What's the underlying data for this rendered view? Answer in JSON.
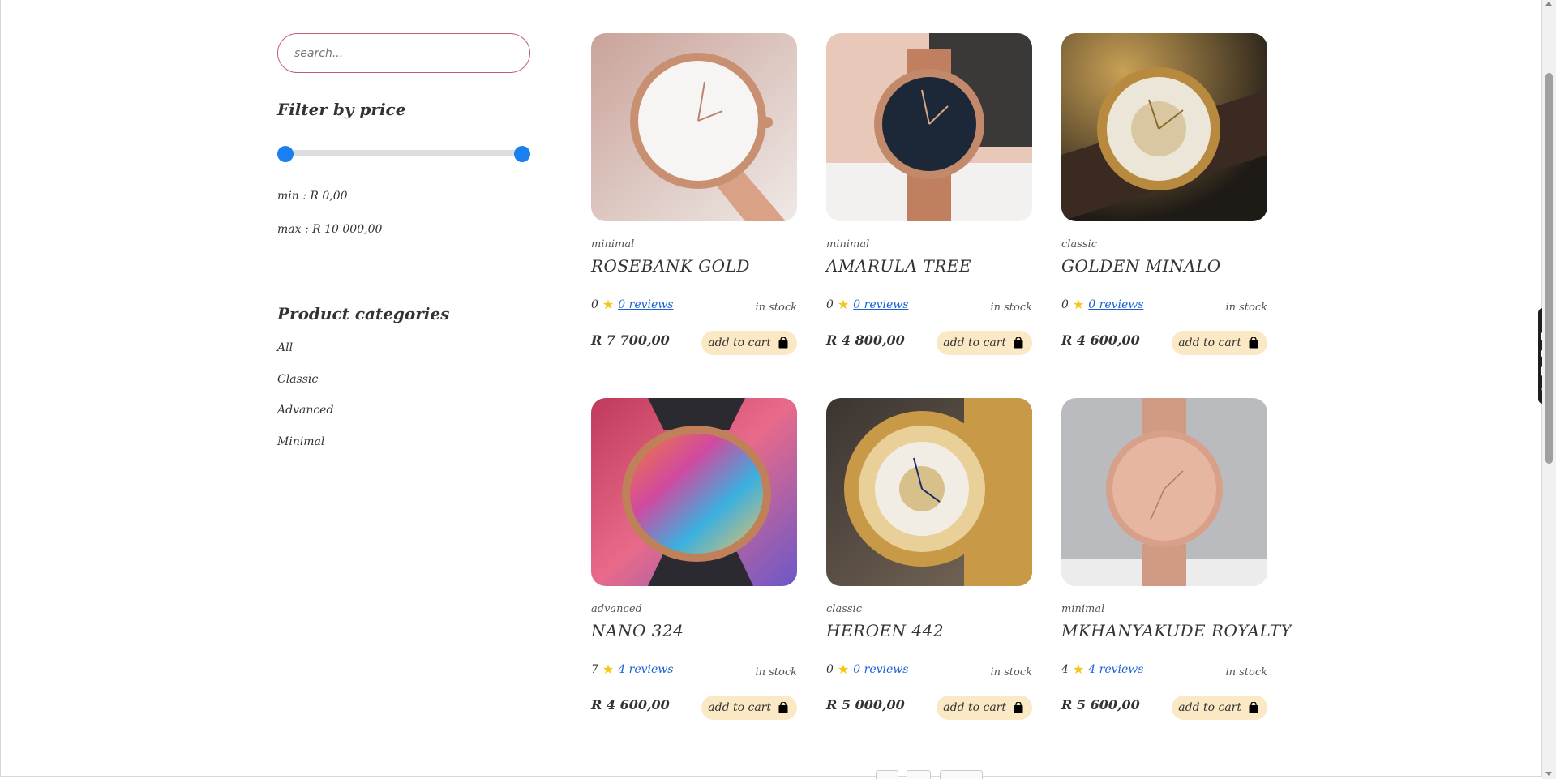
{
  "search": {
    "placeholder": "search..."
  },
  "filter": {
    "heading": "Filter by price",
    "min_label": "min : R 0,00",
    "max_label": "max : R 10 000,00"
  },
  "categories": {
    "heading": "Product categories",
    "items": [
      "All",
      "Classic",
      "Advanced",
      "Minimal"
    ]
  },
  "products": [
    {
      "category": "minimal",
      "name": "ROSEBANK GOLD",
      "rating": "0",
      "reviews": "0 reviews",
      "stock": "in stock",
      "price": "R 7 700,00",
      "cart": "add to cart"
    },
    {
      "category": "minimal",
      "name": "AMARULA TREE",
      "rating": "0",
      "reviews": "0 reviews",
      "stock": "in stock",
      "price": "R 4 800,00",
      "cart": "add to cart"
    },
    {
      "category": "classic",
      "name": "GOLDEN MINALO",
      "rating": "0",
      "reviews": "0 reviews",
      "stock": "in stock",
      "price": "R 4 600,00",
      "cart": "add to cart"
    },
    {
      "category": "advanced",
      "name": "NANO 324",
      "rating": "7",
      "reviews": "4 reviews",
      "stock": "in stock",
      "price": "R 4 600,00",
      "cart": "add to cart"
    },
    {
      "category": "classic",
      "name": "HEROEN 442",
      "rating": "0",
      "reviews": "0 reviews",
      "stock": "in stock",
      "price": "R 5 000,00",
      "cart": "add to cart"
    },
    {
      "category": "minimal",
      "name": "MKHANYAKUDE ROYALTY",
      "rating": "4",
      "reviews": "4 reviews",
      "stock": "in stock",
      "price": "R 5 600,00",
      "cart": "add to cart"
    }
  ],
  "colors": {
    "accent": "#1a7ff0",
    "cart_bg": "#fbe8c4",
    "search_border": "#c85a6e",
    "star": "#f5c518"
  }
}
